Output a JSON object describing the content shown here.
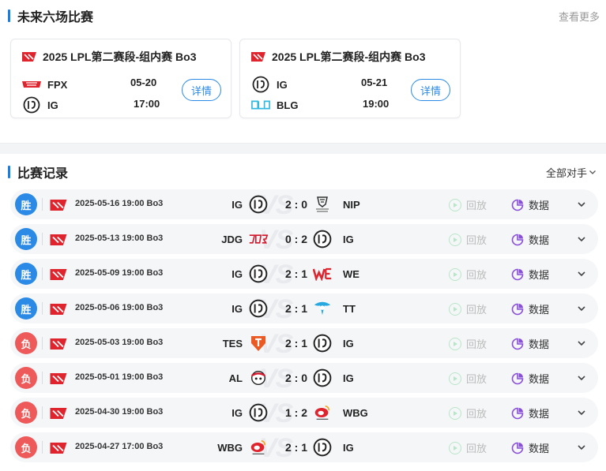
{
  "upcoming": {
    "title": "未来六场比赛",
    "more_label": "查看更多",
    "cards": [
      {
        "league": "2025 LPL第二赛段-组内赛 Bo3",
        "team1": "FPX",
        "team2": "IG",
        "date": "05-20",
        "time": "17:00",
        "detail_label": "详情"
      },
      {
        "league": "2025 LPL第二赛段-组内赛 Bo3",
        "team1": "IG",
        "team2": "BLG",
        "date": "05-21",
        "time": "19:00",
        "detail_label": "详情"
      }
    ]
  },
  "records": {
    "title": "比赛记录",
    "filter_label": "全部对手",
    "replay_label": "回放",
    "stats_label": "数据",
    "matches": [
      {
        "result": "胜",
        "datetime": "2025-05-16 19:00 Bo3",
        "team1": "IG",
        "score": "2 : 0",
        "team2": "NIP"
      },
      {
        "result": "胜",
        "datetime": "2025-05-13 19:00 Bo3",
        "team1": "JDG",
        "score": "0 : 2",
        "team2": "IG"
      },
      {
        "result": "胜",
        "datetime": "2025-05-09 19:00 Bo3",
        "team1": "IG",
        "score": "2 : 1",
        "team2": "WE"
      },
      {
        "result": "胜",
        "datetime": "2025-05-06 19:00 Bo3",
        "team1": "IG",
        "score": "2 : 1",
        "team2": "TT"
      },
      {
        "result": "负",
        "datetime": "2025-05-03 19:00 Bo3",
        "team1": "TES",
        "score": "2 : 1",
        "team2": "IG"
      },
      {
        "result": "负",
        "datetime": "2025-05-01 19:00 Bo3",
        "team1": "AL",
        "score": "2 : 0",
        "team2": "IG"
      },
      {
        "result": "负",
        "datetime": "2025-04-30 19:00 Bo3",
        "team1": "IG",
        "score": "1 : 2",
        "team2": "WBG"
      },
      {
        "result": "负",
        "datetime": "2025-04-27 17:00 Bo3",
        "team1": "WBG",
        "score": "2 : 1",
        "team2": "IG"
      }
    ]
  },
  "vs_watermark": "VS",
  "colors": {
    "win": "#2b8ae6",
    "lose": "#ee5a5a",
    "accent": "#1a7ee0",
    "lpl": "#e0242d"
  }
}
